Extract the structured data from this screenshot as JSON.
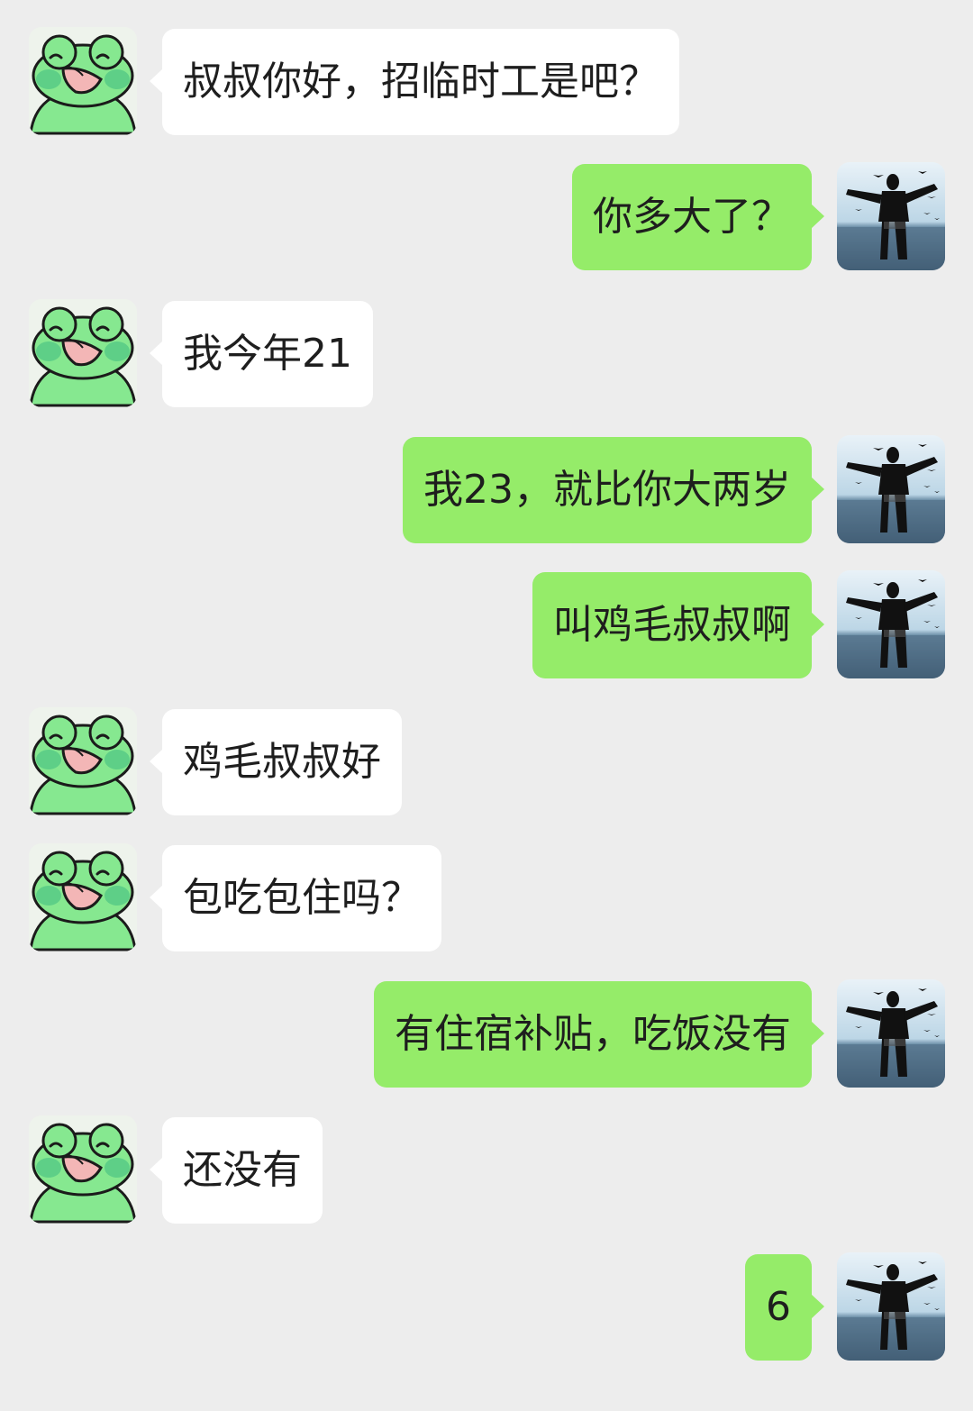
{
  "chat": {
    "messages": [
      {
        "side": "left",
        "avatar": "frog-avatar-icon",
        "text": "叔叔你好，招临时工是吧？"
      },
      {
        "side": "right",
        "avatar": "man-seagulls-avatar-icon",
        "text": "你多大了？"
      },
      {
        "side": "left",
        "avatar": "frog-avatar-icon",
        "text": "我今年21"
      },
      {
        "side": "right",
        "avatar": "man-seagulls-avatar-icon",
        "text": "我23，就比你大两岁"
      },
      {
        "side": "right",
        "avatar": "man-seagulls-avatar-icon",
        "text": "叫鸡毛叔叔啊"
      },
      {
        "side": "left",
        "avatar": "frog-avatar-icon",
        "text": "鸡毛叔叔好"
      },
      {
        "side": "left",
        "avatar": "frog-avatar-icon",
        "text": "包吃包住吗？"
      },
      {
        "side": "right",
        "avatar": "man-seagulls-avatar-icon",
        "text": "有住宿补贴，吃饭没有"
      },
      {
        "side": "left",
        "avatar": "frog-avatar-icon",
        "text": "还没有"
      },
      {
        "side": "right",
        "avatar": "man-seagulls-avatar-icon",
        "text": "6"
      }
    ]
  },
  "colors": {
    "background": "#ededed",
    "incoming_bubble": "#ffffff",
    "outgoing_bubble": "#95ec69",
    "text": "#1e1e1e"
  }
}
